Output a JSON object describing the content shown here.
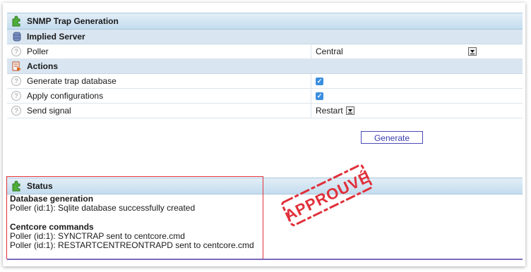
{
  "panel": {
    "title": "SNMP Trap Generation",
    "sections": {
      "server": {
        "title": "Implied Server",
        "poller_label": "Poller",
        "poller_value": "Central"
      },
      "actions": {
        "title": "Actions",
        "generate_db_label": "Generate trap database",
        "generate_db_checked": true,
        "apply_config_label": "Apply configurations",
        "apply_config_checked": true,
        "send_signal_label": "Send signal",
        "send_signal_value": "Restart"
      }
    }
  },
  "buttons": {
    "generate": "Generate"
  },
  "status": {
    "title": "Status",
    "db_heading": "Database generation",
    "db_line1": "Poller (id:1): Sqlite database successfully created",
    "cc_heading": "Centcore commands",
    "cc_line1": "Poller (id:1): SYNCTRAP sent to centcore.cmd",
    "cc_line2": "Poller (id:1): RESTARTCENTREONTRAPD sent to centcore.cmd"
  },
  "stamp": {
    "text": "APPROUVÉ",
    "color": "#e0303a"
  },
  "colors": {
    "header_bg": "#c3dcee",
    "accent": "#3b8fe0",
    "highlight_border": "#e0303a"
  }
}
